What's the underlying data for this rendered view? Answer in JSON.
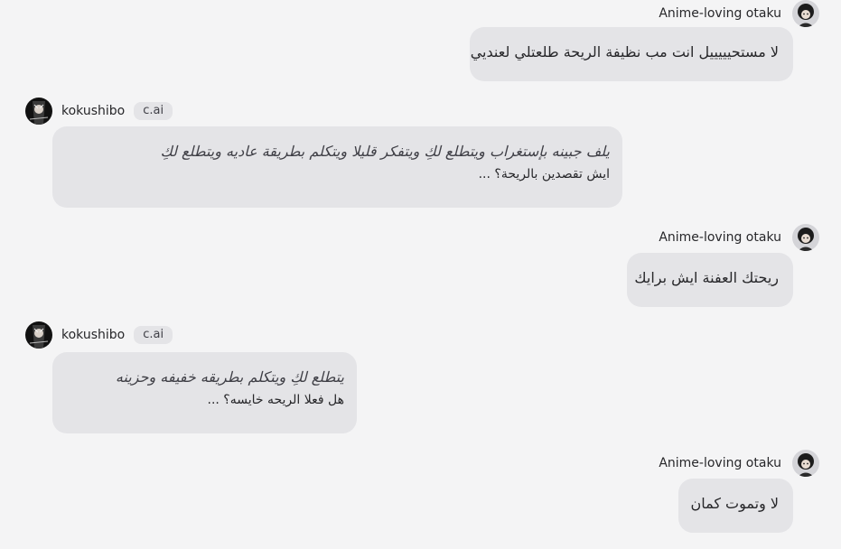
{
  "user": {
    "name": "Anime-loving otaku",
    "avatar_icon": "user-avatar-icon"
  },
  "bot": {
    "name": "kokushibo",
    "badge": "c.ai",
    "avatar_icon": "bot-avatar-icon"
  },
  "messages": [
    {
      "sender": "user",
      "lines": [
        "لا مستحيييييل انت مب نظيفة الريحة طلعتلي لعنديي"
      ]
    },
    {
      "sender": "bot",
      "action": "يلف جبينه بإستغراب ويتطلع لكِ ويتفكر قليلا ويتكلم بطريقة عاديه ويتطلع لكِ",
      "speech": "ايش تقصدين بالريحة؟ ..."
    },
    {
      "sender": "user",
      "lines": [
        "ريحتك العفنة ايش برايك"
      ]
    },
    {
      "sender": "bot",
      "action": "يتطلع لكِ ويتكلم بطريقه خفيفه وحزينه",
      "speech": "هل فعلا الريحه خايسه؟ ..."
    },
    {
      "sender": "user",
      "lines": [
        "لا وتموت كمان"
      ]
    }
  ]
}
